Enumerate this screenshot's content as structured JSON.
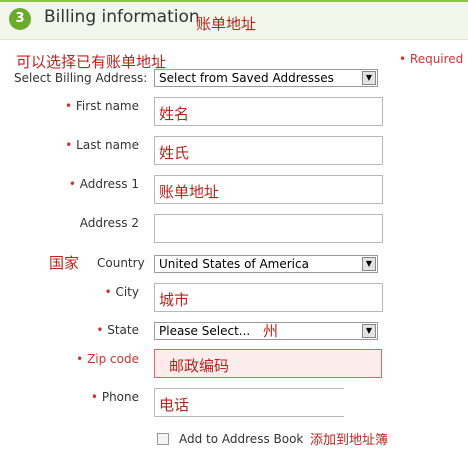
{
  "header": {
    "step": "3",
    "title": "Billing information",
    "annotation": "账单地址"
  },
  "required_note": "• Required",
  "saved_address": {
    "annotation": "可以选择已有账单地址",
    "label": "Select Billing Address:",
    "value": "Select from Saved Addresses"
  },
  "fields": {
    "first_name": {
      "marker": "•",
      "label": "First name",
      "value": "姓名"
    },
    "last_name": {
      "marker": "•",
      "label": "Last name",
      "value": "姓氏"
    },
    "address1": {
      "marker": "•",
      "label": "Address 1",
      "value": "账单地址"
    },
    "address2": {
      "label": "Address 2",
      "value": ""
    },
    "country": {
      "annotation": "国家",
      "label": "Country",
      "value": "United States of America"
    },
    "city": {
      "marker": "•",
      "label": "City",
      "value": "城市"
    },
    "state": {
      "marker": "•",
      "label": "State",
      "value": "Please Select...",
      "annotation": "州"
    },
    "zip": {
      "label": "• Zip code",
      "value": "邮政编码"
    },
    "phone": {
      "marker": "•",
      "label": "Phone",
      "value": "电话"
    }
  },
  "add_to_book": {
    "label": "Add to Address Book",
    "annotation": "添加到地址簿",
    "checked": false
  },
  "colors": {
    "accent": "#6aab2e",
    "annotation": "#b3261e",
    "required": "#cc3333",
    "zip_error_bg": "#fcecec"
  }
}
